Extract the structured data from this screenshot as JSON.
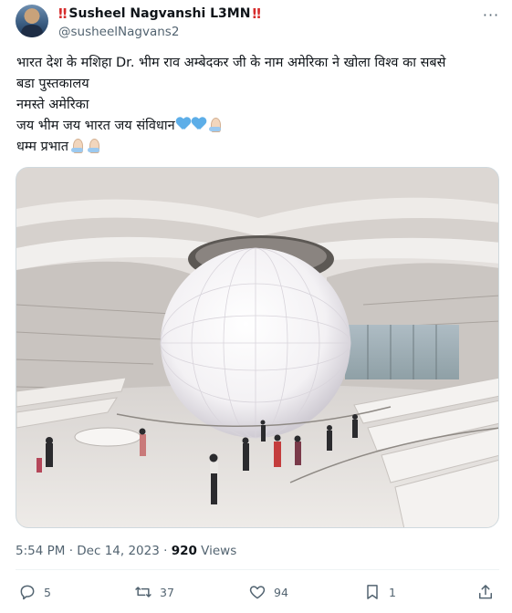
{
  "author": {
    "display_name": "Susheel Nagvanshi L3MN",
    "badge_left": "‼",
    "badge_right": "‼",
    "handle": "@susheelNagvans2"
  },
  "menu": {
    "more_label": "···"
  },
  "tweet": {
    "lines": [
      "भारत देश के मशिहा Dr. भीम राव अम्बेदकर जी के नाम अमेरिका ने खोला विश्व का सबसे",
      "बडा पुस्तकालय",
      "नमस्ते अमेरिका",
      "जय भीम जय भारत जय संविधान",
      " धम्म प्रभात"
    ],
    "line4_emoji": [
      "blue-heart",
      "blue-heart",
      "folded-hands"
    ],
    "line5_emoji": [
      "folded-hands",
      "folded-hands"
    ]
  },
  "meta": {
    "time": "5:54 PM",
    "separator": " · ",
    "date": "Dec 14, 2023",
    "views_count": "920",
    "views_label": " Views"
  },
  "actions": {
    "replies": "5",
    "reposts": "37",
    "likes": "94",
    "bookmarks": "1"
  },
  "colors": {
    "text": "#0f1419",
    "secondary": "#536471",
    "heart_emoji": "#5daee8",
    "badge_red": "#d62b2b"
  }
}
